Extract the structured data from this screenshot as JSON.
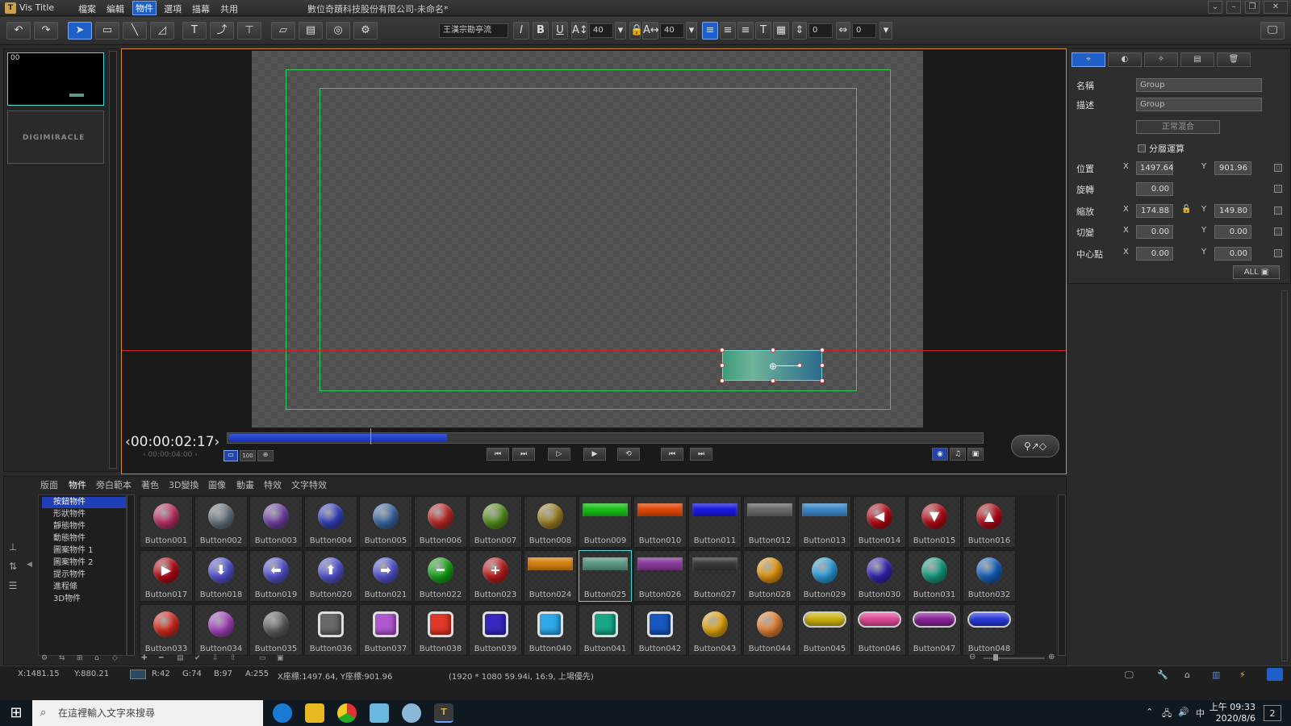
{
  "titlebar": {
    "app": "Vis Title",
    "doc_title": "數位奇蹟科技股份有限公司-未命名*",
    "menu": [
      "檔案",
      "編輯",
      "物件",
      "選項",
      "描幕",
      "共用"
    ],
    "active_menu": "物件"
  },
  "toolbar": {
    "font_name": "王漢宗勘亭流",
    "font_size": "40",
    "font_size2": "40",
    "spacing1": "0",
    "spacing2": "0"
  },
  "thumbs": {
    "first_label": "00",
    "second_label": "DIGIMIRACLE"
  },
  "timeline": {
    "timecode": "00:00:02:17",
    "duration": "00:00:04:00",
    "progress": 0.29,
    "zoom_label": "100"
  },
  "properties": {
    "name_label": "名稱",
    "name_value": "Group",
    "desc_label": "描述",
    "desc_value": "Group",
    "blend": "正常混合",
    "layer_calc": "分層運算",
    "pos_label": "位置",
    "pos_x": "1497.64",
    "pos_y": "901.96",
    "rot_label": "旋轉",
    "rot": "0.00",
    "scale_label": "縮放",
    "scale_x": "174.88",
    "scale_y": "149.80",
    "skew_label": "切變",
    "skew_x": "0.00",
    "skew_y": "0.00",
    "center_label": "中心點",
    "center_x": "0.00",
    "center_y": "0.00",
    "x": "X",
    "y": "Y",
    "all": "ALL"
  },
  "library": {
    "tabs": [
      "版面",
      "物件",
      "旁白範本",
      "著色",
      "3D變換",
      "圖像",
      "動畫",
      "特效",
      "文字特效"
    ],
    "active_tab": "物件",
    "tree": [
      "按鈕物件",
      "形狀物件",
      "靜態物件",
      "動態物件",
      "圖案物件 1",
      "圖案物件 2",
      "提示物件",
      "進程條",
      "3D物件"
    ],
    "selected_item": "Button025",
    "items": [
      {
        "label": "Button001",
        "kind": "ball",
        "color": "#c8356e"
      },
      {
        "label": "Button002",
        "kind": "ball",
        "color": "#6f7d88"
      },
      {
        "label": "Button003",
        "kind": "ball",
        "color": "#7a48b0"
      },
      {
        "label": "Button004",
        "kind": "ball",
        "color": "#3844c8"
      },
      {
        "label": "Button005",
        "kind": "ball",
        "color": "#3f6fb0"
      },
      {
        "label": "Button006",
        "kind": "ball",
        "color": "#c82a2a"
      },
      {
        "label": "Button007",
        "kind": "ball",
        "color": "#5e9a20"
      },
      {
        "label": "Button008",
        "kind": "ball",
        "color": "#a88a2a"
      },
      {
        "label": "Button009",
        "kind": "bar",
        "color": "#18c018"
      },
      {
        "label": "Button010",
        "kind": "bar",
        "color": "#e04808"
      },
      {
        "label": "Button011",
        "kind": "bar",
        "color": "#1818e0"
      },
      {
        "label": "Button012",
        "kind": "bar",
        "color": "#6a6a6a"
      },
      {
        "label": "Button013",
        "kind": "bar",
        "color": "#3d88c8"
      },
      {
        "label": "Button014",
        "kind": "ball",
        "color": "#c00c18",
        "glyph": "◀"
      },
      {
        "label": "Button015",
        "kind": "ball",
        "color": "#c00c18",
        "glyph": "▼"
      },
      {
        "label": "Button016",
        "kind": "ball",
        "color": "#c00c18",
        "glyph": "▲"
      },
      {
        "label": "Button017",
        "kind": "ball",
        "color": "#c00c18",
        "glyph": "▶"
      },
      {
        "label": "Button018",
        "kind": "ball",
        "color": "#5a5ae0",
        "glyph": "⬇"
      },
      {
        "label": "Button019",
        "kind": "ball",
        "color": "#5a5ae0",
        "glyph": "⬅"
      },
      {
        "label": "Button020",
        "kind": "ball",
        "color": "#5a5ae0",
        "glyph": "⬆"
      },
      {
        "label": "Button021",
        "kind": "ball",
        "color": "#5a5ae0",
        "glyph": "➡"
      },
      {
        "label": "Button022",
        "kind": "ball",
        "color": "#18b018",
        "glyph": "━"
      },
      {
        "label": "Button023",
        "kind": "ball",
        "color": "#c82020",
        "glyph": "+"
      },
      {
        "label": "Button024",
        "kind": "bar",
        "color": "#d88010"
      },
      {
        "label": "Button025",
        "kind": "bar",
        "color": "#5e9a88"
      },
      {
        "label": "Button026",
        "kind": "bar",
        "color": "#8a3a9a"
      },
      {
        "label": "Button027",
        "kind": "bar",
        "color": "#3a3a3a"
      },
      {
        "label": "Button028",
        "kind": "ball",
        "color": "#f0a010"
      },
      {
        "label": "Button029",
        "kind": "ball",
        "color": "#30a8e8"
      },
      {
        "label": "Button030",
        "kind": "ball",
        "color": "#3828c0"
      },
      {
        "label": "Button031",
        "kind": "ball",
        "color": "#18a888"
      },
      {
        "label": "Button032",
        "kind": "ball",
        "color": "#1868c8"
      },
      {
        "label": "Button033",
        "kind": "ball",
        "color": "#e03020"
      },
      {
        "label": "Button034",
        "kind": "ball",
        "color": "#b048c8"
      },
      {
        "label": "Button035",
        "kind": "ball",
        "color": "#686868"
      },
      {
        "label": "Button036",
        "kind": "sq",
        "color": "#686868"
      },
      {
        "label": "Button037",
        "kind": "sq",
        "color": "#b058d0"
      },
      {
        "label": "Button038",
        "kind": "sq",
        "color": "#e03828"
      },
      {
        "label": "Button039",
        "kind": "sq",
        "color": "#3828c0"
      },
      {
        "label": "Button040",
        "kind": "sq",
        "color": "#30a8e8"
      },
      {
        "label": "Button041",
        "kind": "sq",
        "color": "#18a888"
      },
      {
        "label": "Button042",
        "kind": "sq",
        "color": "#1858c0"
      },
      {
        "label": "Button043",
        "kind": "ball",
        "color": "#f0b010"
      },
      {
        "label": "Button044",
        "kind": "ball",
        "color": "#f08838"
      },
      {
        "label": "Button045",
        "kind": "pill",
        "color": "#c8b010"
      },
      {
        "label": "Button046",
        "kind": "pill",
        "color": "#e04898"
      },
      {
        "label": "Button047",
        "kind": "pill",
        "color": "#882098"
      },
      {
        "label": "Button048",
        "kind": "pill",
        "color": "#2838d8"
      }
    ]
  },
  "status": {
    "x": "X:1481.15",
    "y": "Y:880.21",
    "r": "R:42",
    "g": "G:74",
    "b": "B:97",
    "a": "A:255",
    "coords": "X座標:1497.64, Y座標:901.96",
    "format": "(1920 * 1080 59.94i, 16:9, 上場優先)",
    "swatch": "#2a4a61"
  },
  "taskbar": {
    "search_placeholder": "在這裡輸入文字來搜尋",
    "time": "上午 09:33",
    "date": "2020/8/6",
    "ime": "中",
    "notif": "2"
  }
}
